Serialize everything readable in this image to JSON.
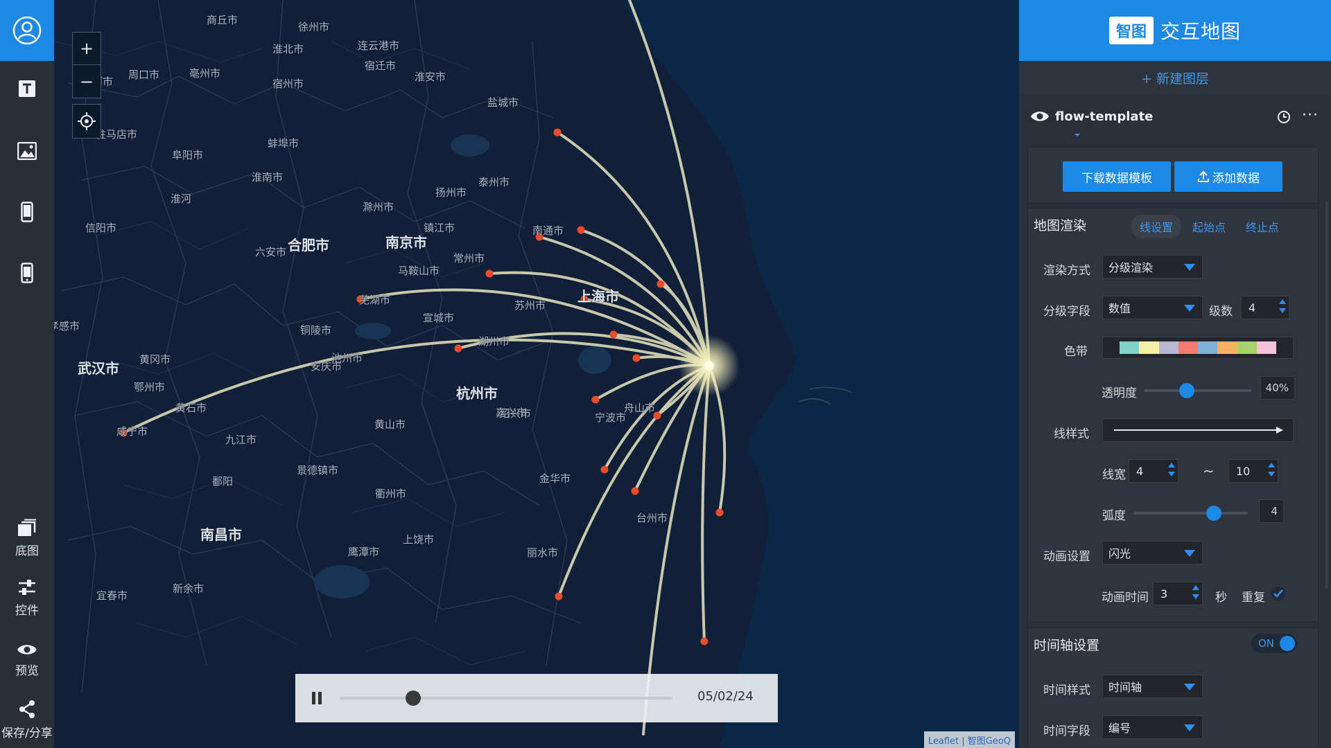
{
  "toolbar": {
    "items": [
      {
        "icon": "text-icon",
        "label": ""
      },
      {
        "icon": "image-icon",
        "label": ""
      },
      {
        "icon": "phone-icon",
        "label": ""
      },
      {
        "icon": "mobile-icon",
        "label": ""
      },
      {
        "icon": "basemap-icon",
        "label": "底图"
      },
      {
        "icon": "sliders-icon",
        "label": "控件"
      },
      {
        "icon": "eye-icon",
        "label": "预览"
      },
      {
        "icon": "share-icon",
        "label": "保存/分享"
      }
    ]
  },
  "map": {
    "zoom_in": "+",
    "zoom_out": "−",
    "cities": [
      {
        "name": "商丘市",
        "big": false
      },
      {
        "name": "徐州市",
        "big": false
      },
      {
        "name": "连云港市",
        "big": false
      },
      {
        "name": "淮北市",
        "big": false
      },
      {
        "name": "宿迁市",
        "big": false
      },
      {
        "name": "漯河市",
        "big": false
      },
      {
        "name": "周口市",
        "big": false
      },
      {
        "name": "亳州市",
        "big": false
      },
      {
        "name": "宿州市",
        "big": false
      },
      {
        "name": "淮安市",
        "big": false
      },
      {
        "name": "盐城市",
        "big": false
      },
      {
        "name": "驻马店市",
        "big": false
      },
      {
        "name": "阜阳市",
        "big": false
      },
      {
        "name": "蚌埠市",
        "big": false
      },
      {
        "name": "淮南市",
        "big": false
      },
      {
        "name": "淮河",
        "big": false
      },
      {
        "name": "扬州市",
        "big": false
      },
      {
        "name": "泰州市",
        "big": false
      },
      {
        "name": "滁州市",
        "big": false
      },
      {
        "name": "信阳市",
        "big": false
      },
      {
        "name": "合肥市",
        "big": true
      },
      {
        "name": "南京市",
        "big": true
      },
      {
        "name": "镇江市",
        "big": false
      },
      {
        "name": "南通市",
        "big": false
      },
      {
        "name": "六安市",
        "big": false
      },
      {
        "name": "马鞍山市",
        "big": false
      },
      {
        "name": "常州市",
        "big": false
      },
      {
        "name": "上海市",
        "big": true
      },
      {
        "name": "芜湖市",
        "big": false
      },
      {
        "name": "苏州市",
        "big": false
      },
      {
        "name": "孝感市",
        "big": false
      },
      {
        "name": "铜陵市",
        "big": false
      },
      {
        "name": "宣城市",
        "big": false
      },
      {
        "name": "湖州市",
        "big": false
      },
      {
        "name": "武汉市",
        "big": true
      },
      {
        "name": "黄冈市",
        "big": false
      },
      {
        "name": "安庆市",
        "big": false
      },
      {
        "name": "池州市",
        "big": false
      },
      {
        "name": "嘉兴市",
        "big": false
      },
      {
        "name": "鄂州市",
        "big": false
      },
      {
        "name": "杭州市",
        "big": true
      },
      {
        "name": "黄石市",
        "big": false
      },
      {
        "name": "绍兴市",
        "big": false
      },
      {
        "name": "宁波市",
        "big": false
      },
      {
        "name": "舟山市",
        "big": false
      },
      {
        "name": "咸宁市",
        "big": false
      },
      {
        "name": "九江市",
        "big": false
      },
      {
        "name": "黄山市",
        "big": false
      },
      {
        "name": "景德镇市",
        "big": false
      },
      {
        "name": "金华市",
        "big": false
      },
      {
        "name": "鄱阳",
        "big": false
      },
      {
        "name": "衢州市",
        "big": false
      },
      {
        "name": "台州市",
        "big": false
      },
      {
        "name": "南昌市",
        "big": true
      },
      {
        "name": "上饶市",
        "big": false
      },
      {
        "name": "鹰潭市",
        "big": false
      },
      {
        "name": "丽水市",
        "big": false
      },
      {
        "name": "宜春市",
        "big": false
      },
      {
        "name": "新余市",
        "big": false
      }
    ],
    "attribution": "Leaflet | 智图GeoQ"
  },
  "timeline": {
    "date": "05/02/24",
    "progress": 0.22
  },
  "panel": {
    "brand_badge": "智图",
    "brand_title": "交互地图",
    "new_layer": "+ 新建图层",
    "layer_name": "flow-template",
    "more": "···",
    "btn_download": "下载数据模板",
    "btn_add": "添加数据",
    "render_section": "地图渲染",
    "tabs": [
      "线设置",
      "起始点",
      "终止点"
    ],
    "render_mode_label": "渲染方式",
    "render_mode_value": "分级渲染",
    "class_field_label": "分级字段",
    "class_field_value": "数值",
    "levels_label": "级数",
    "levels_value": "4",
    "ribbon_label": "色带",
    "ribbon_colors": [
      "#7fd3c4",
      "#f3f0a8",
      "#b9b7d6",
      "#f27a6f",
      "#7db1d8",
      "#f6b25e",
      "#a6d26b",
      "#f4c3d8"
    ],
    "opacity_label": "透明度",
    "opacity_value": "40%",
    "opacity_fraction": 0.4,
    "line_style_label": "线样式",
    "line_width_label": "线宽",
    "line_width_min": "4",
    "line_width_sep": "~",
    "line_width_max": "10",
    "arc_label": "弧度",
    "arc_value": "4",
    "arc_fraction": 0.7,
    "anim_label": "动画设置",
    "anim_value": "闪光",
    "anim_time_label": "动画时间",
    "anim_time_value": "3",
    "anim_time_unit": "秒",
    "repeat_label": "重复",
    "timeline_section": "时间轴设置",
    "toggle_on": "ON",
    "time_style_label": "时间样式",
    "time_style_value": "时间轴",
    "time_field_label": "时间字段",
    "time_field_value": "编号"
  }
}
